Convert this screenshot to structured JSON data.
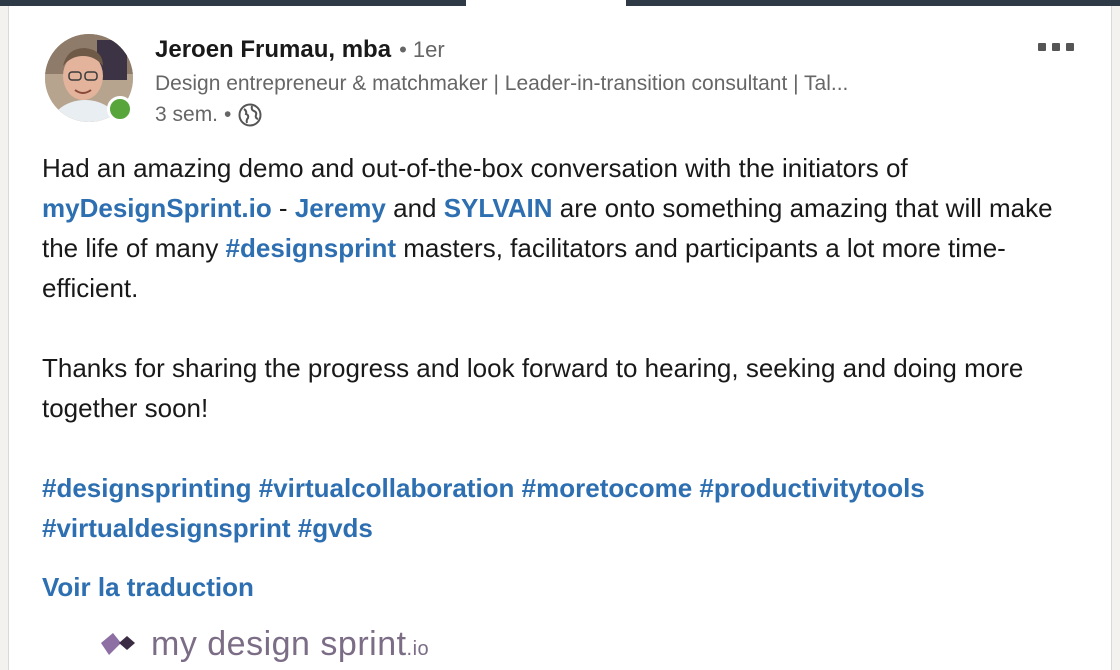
{
  "post": {
    "author_name": "Jeroen Frumau, mba",
    "connection_degree": "• 1er",
    "headline": "Design entrepreneur & matchmaker | Leader-in-transition consultant | Tal...",
    "time_ago": "3 sem.",
    "meta_separator": "•",
    "visibility_icon": "globe-icon",
    "body": {
      "p1_start": "Had an amazing demo and out-of-the-box conversation with the initiators of",
      "link_site": "myDesignSprint.io",
      "dash": " - ",
      "mention_1": "Jeremy",
      "and_text": " and ",
      "mention_2": "SYLVAIN",
      "p1_mid": " are onto something amazing that will make the life of many ",
      "hashtag_inline": "#designsprint",
      "p1_end": " masters, facilitators and participants a lot more time-efficient.",
      "p2": "Thanks for sharing the progress and look forward to hearing, seeking and doing more together soon!"
    },
    "hashtags": [
      "#designsprinting",
      "#virtualcollaboration",
      "#moretocome",
      "#productivitytools",
      "#virtualdesignsprint",
      "#gvds"
    ],
    "translate_label": "Voir la traduction",
    "preview_logo": {
      "name": "my design sprint",
      "suffix": ".io"
    }
  },
  "colors": {
    "link": "#2d6fb1",
    "text": "#191919",
    "muted": "#666666",
    "presence": "#57a53b"
  }
}
